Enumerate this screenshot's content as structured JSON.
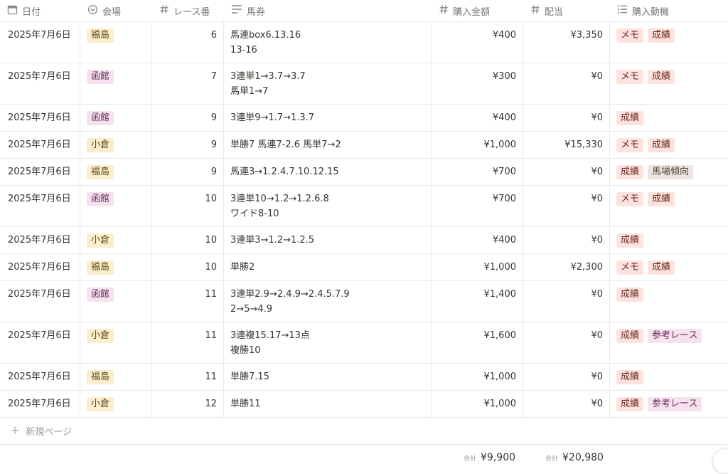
{
  "columns": [
    {
      "key": "date",
      "label": "日付",
      "icon": "calendar-icon"
    },
    {
      "key": "venue",
      "label": "会場",
      "icon": "select-icon"
    },
    {
      "key": "race",
      "label": "レース番",
      "icon": "hash-icon"
    },
    {
      "key": "ticket",
      "label": "馬券",
      "icon": "text-icon"
    },
    {
      "key": "amount",
      "label": "購入金額",
      "icon": "hash-icon"
    },
    {
      "key": "payout",
      "label": "配当",
      "icon": "hash-icon"
    },
    {
      "key": "motive",
      "label": "購入動機",
      "icon": "multiselect-icon"
    }
  ],
  "tag_colors": {
    "福島": {
      "bg": "#fbeecc",
      "fg": "#5f4b1a"
    },
    "小倉": {
      "bg": "#fbeecc",
      "fg": "#5f4b1a"
    },
    "函館": {
      "bg": "#f6e1ef",
      "fg": "#6b2f55"
    },
    "メモ": {
      "bg": "#fde2dd",
      "fg": "#6b2a22"
    },
    "成績": {
      "bg": "#fde2dd",
      "fg": "#6b2a22"
    },
    "馬場傾向": {
      "bg": "#ece5e1",
      "fg": "#54413a"
    },
    "参考レース": {
      "bg": "#f6e1ef",
      "fg": "#6b2f55"
    }
  },
  "rows": [
    {
      "date": "2025年7月6日",
      "venue": "福島",
      "race": "6",
      "ticket": [
        "馬連box6.13.16",
        "13-16"
      ],
      "amount": "¥400",
      "payout": "¥3,350",
      "motive": [
        "メモ",
        "成績"
      ]
    },
    {
      "date": "2025年7月6日",
      "venue": "函館",
      "race": "7",
      "ticket": [
        "3連単1→3.7→3.7",
        "馬単1→7"
      ],
      "amount": "¥300",
      "payout": "¥0",
      "motive": [
        "メモ",
        "成績"
      ]
    },
    {
      "date": "2025年7月6日",
      "venue": "函館",
      "race": "9",
      "ticket": [
        "3連単9→1.7→1.3.7"
      ],
      "amount": "¥400",
      "payout": "¥0",
      "motive": [
        "成績"
      ]
    },
    {
      "date": "2025年7月6日",
      "venue": "小倉",
      "race": "9",
      "ticket": [
        "単勝7 馬連7-2.6 馬単7→2"
      ],
      "amount": "¥1,000",
      "payout": "¥15,330",
      "motive": [
        "メモ",
        "成績"
      ]
    },
    {
      "date": "2025年7月6日",
      "venue": "福島",
      "race": "9",
      "ticket": [
        "馬連3→1.2.4.7.10.12.15"
      ],
      "amount": "¥700",
      "payout": "¥0",
      "motive": [
        "成績",
        "馬場傾向"
      ]
    },
    {
      "date": "2025年7月6日",
      "venue": "函館",
      "race": "10",
      "ticket": [
        "3連単10→1.2→1.2.6.8",
        "ワイド8-10"
      ],
      "amount": "¥700",
      "payout": "¥0",
      "motive": [
        "メモ",
        "成績"
      ]
    },
    {
      "date": "2025年7月6日",
      "venue": "小倉",
      "race": "10",
      "ticket": [
        "3連単3→1.2→1.2.5"
      ],
      "amount": "¥400",
      "payout": "¥0",
      "motive": [
        "成績"
      ]
    },
    {
      "date": "2025年7月6日",
      "venue": "福島",
      "race": "10",
      "ticket": [
        "単勝2"
      ],
      "amount": "¥1,000",
      "payout": "¥2,300",
      "motive": [
        "メモ",
        "成績"
      ]
    },
    {
      "date": "2025年7月6日",
      "venue": "函館",
      "race": "11",
      "ticket": [
        "3連単2.9→2.4.9→2.4.5.7.9",
        "2→5→4.9"
      ],
      "amount": "¥1,400",
      "payout": "¥0",
      "motive": [
        "成績"
      ]
    },
    {
      "date": "2025年7月6日",
      "venue": "小倉",
      "race": "11",
      "ticket": [
        "3連複15.17→13点",
        "複勝10"
      ],
      "amount": "¥1,600",
      "payout": "¥0",
      "motive": [
        "成績",
        "参考レース"
      ]
    },
    {
      "date": "2025年7月6日",
      "venue": "福島",
      "race": "11",
      "ticket": [
        "単勝7.15"
      ],
      "amount": "¥1,000",
      "payout": "¥0",
      "motive": [
        "成績"
      ]
    },
    {
      "date": "2025年7月6日",
      "venue": "小倉",
      "race": "12",
      "ticket": [
        "単勝11"
      ],
      "amount": "¥1,000",
      "payout": "¥0",
      "motive": [
        "成績",
        "参考レース"
      ]
    }
  ],
  "new_page_label": "新規ページ",
  "footer": {
    "amount_label": "合計",
    "amount_total": "¥9,900",
    "payout_label": "合計",
    "payout_total": "¥20,980"
  }
}
